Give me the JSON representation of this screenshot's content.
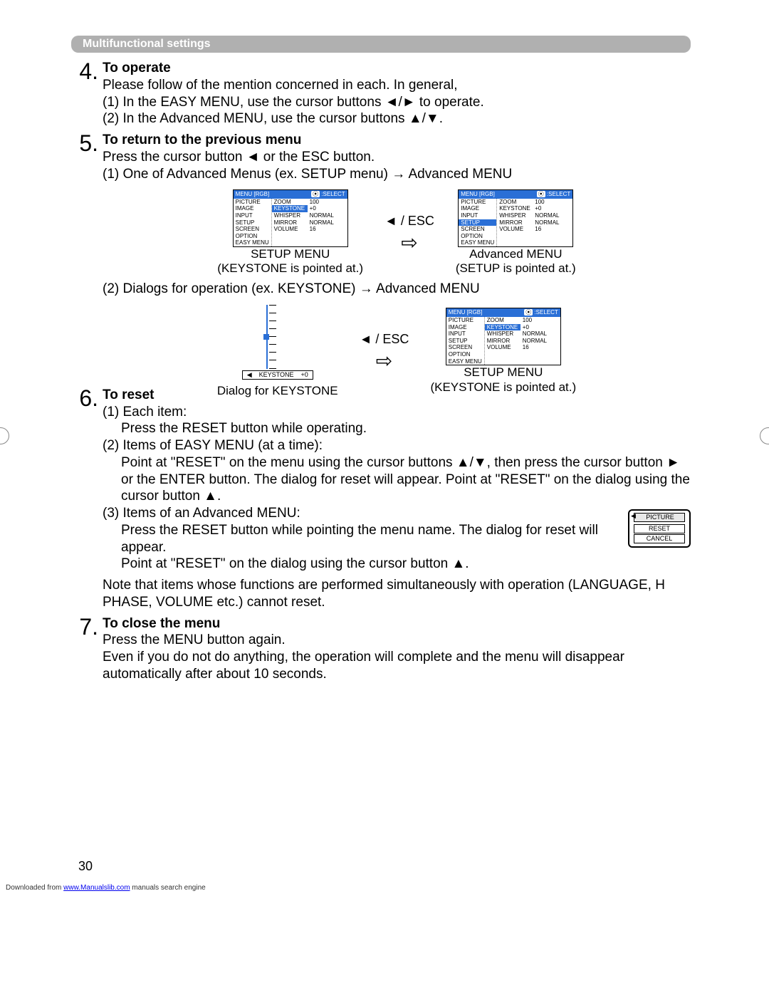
{
  "header": "Multifunctional settings",
  "sections": {
    "s4": {
      "num": "4.",
      "title": "To operate",
      "p1": "Please follow of the mention concerned in each. In general,",
      "p2": "(1) In the EASY MENU, use the cursor buttons ◄/► to operate.",
      "p3": "(2) In the Advanced MENU, use the cursor buttons ▲/▼."
    },
    "s5": {
      "num": "5.",
      "title": "To return to the previous menu",
      "p1": "Press the cursor button ◄ or the ESC button.",
      "p2": "(1) One of Advanced Menus (ex. SETUP menu) → Advanced MENU",
      "p3": "(2) Dialogs for operation (ex. KEYSTONE) → Advanced MENU"
    },
    "s6": {
      "num": "6.",
      "title": "To reset",
      "p1": "(1) Each item:",
      "p1b": "Press the RESET button while operating.",
      "p2": "(2) Items of EASY MENU (at a time):",
      "p2b": "Point at \"RESET\" on the menu using the cursor buttons ▲/▼, then press the cursor button ► or the ENTER button. The dialog for reset will appear. Point at \"RESET\" on the dialog using the cursor button ▲.",
      "p3": "(3) Items of an Advanced MENU:",
      "p3b": "Press the RESET button while pointing the menu name. The dialog for reset will appear.",
      "p3c": "Point at \"RESET\" on the dialog using the cursor button ▲.",
      "note": "Note that items whose functions are performed simultaneously with operation (LANGUAGE, H PHASE, VOLUME etc.) cannot reset."
    },
    "s7": {
      "num": "7.",
      "title": "To close the menu",
      "p1": "Press the MENU button again.",
      "p2": "Even if you do not do anything, the operation will complete and the menu will disappear automatically after about 10 seconds."
    }
  },
  "osd": {
    "head_left": "MENU [RGB]",
    "head_sel_icon": "⦿",
    "head_right": ":SELECT",
    "left": [
      "PICTURE",
      "IMAGE",
      "INPUT",
      "SETUP",
      "SCREEN",
      "OPTION",
      "EASY MENU"
    ],
    "mid": [
      "ZOOM",
      "KEYSTONE",
      "WHISPER",
      "MIRROR",
      "VOLUME"
    ],
    "right": [
      "100",
      "+0",
      "NORMAL",
      "NORMAL",
      "16"
    ]
  },
  "captions": {
    "fig1a_l1": "SETUP MENU",
    "fig1a_l2": "(KEYSTONE is pointed at.)",
    "fig1b_l1": "Advanced MENU",
    "fig1b_l2": "(SETUP is pointed at.)",
    "fig2a_l1": "Dialog for KEYSTONE",
    "fig2b_l1": "SETUP MENU",
    "fig2b_l2": "(KEYSTONE is pointed at.)",
    "arrow_label": "◄ / ESC"
  },
  "kdialog": {
    "tri": "◀",
    "name": "KEYSTONE",
    "val": "+0"
  },
  "reset_dialog": {
    "title": "PICTURE",
    "opt1": "RESET",
    "opt2": "CANCEL",
    "tri": "◀"
  },
  "page_number": "30",
  "footer": {
    "pre": "Downloaded from ",
    "link": "www.Manualslib.com",
    "post": " manuals search engine"
  }
}
